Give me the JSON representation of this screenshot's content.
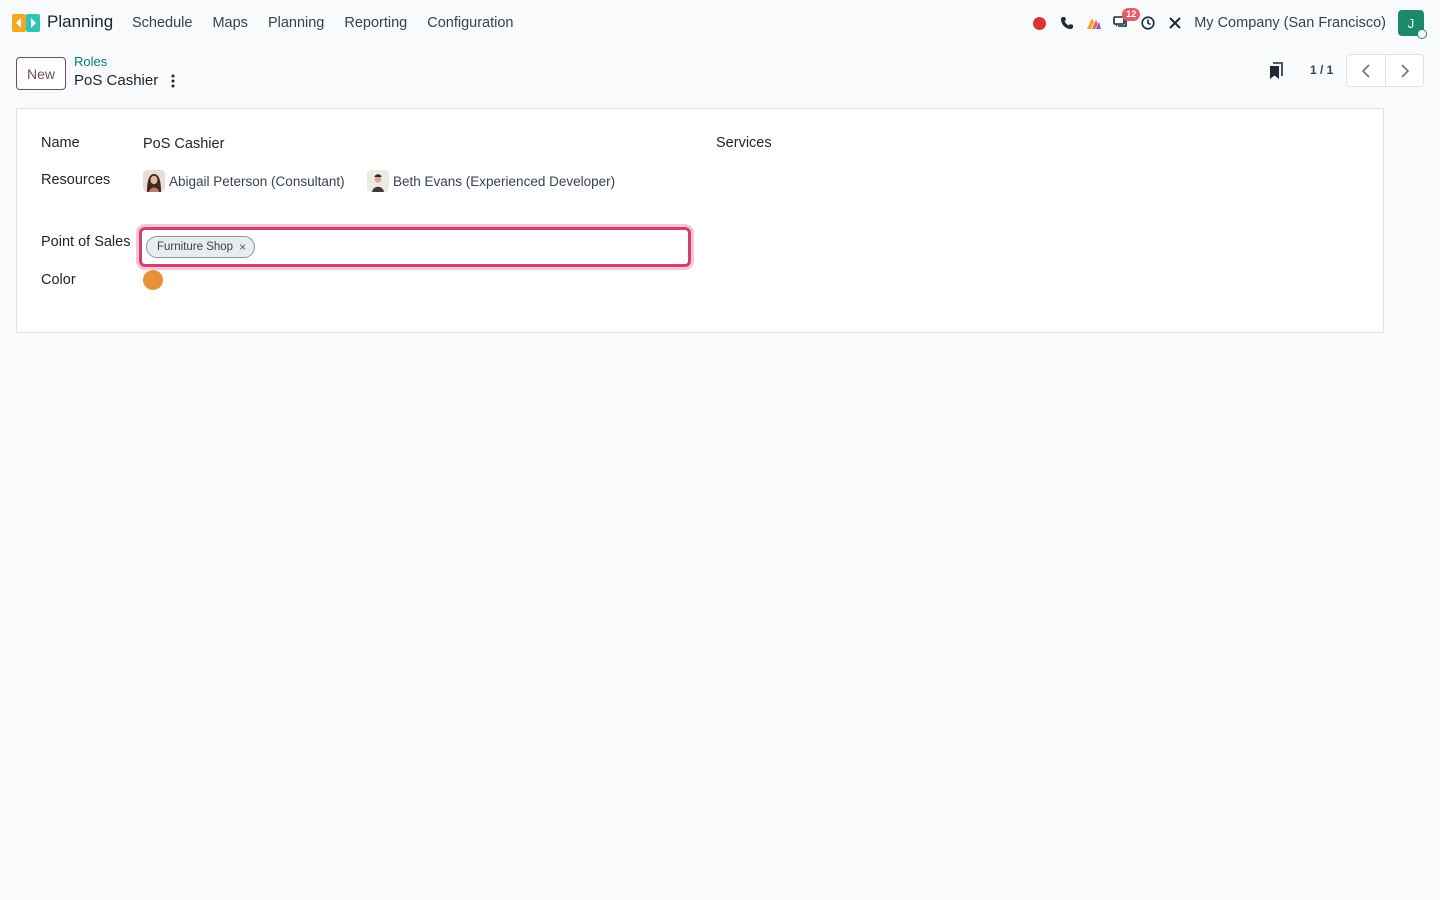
{
  "navbar": {
    "app_name": "Planning",
    "menu": [
      "Schedule",
      "Maps",
      "Planning",
      "Reporting",
      "Configuration"
    ],
    "messages_badge": "12",
    "company": "My Company (San Francisco)",
    "user_initial": "J"
  },
  "control_panel": {
    "new_label": "New",
    "breadcrumb": "Roles",
    "record_title": "PoS Cashier",
    "pager": "1 / 1"
  },
  "form": {
    "name_label": "Name",
    "name_value": "PoS Cashier",
    "services_label": "Services",
    "resources_label": "Resources",
    "resources": [
      "Abigail Peterson (Consultant)",
      "Beth Evans (Experienced Developer)"
    ],
    "pos_label": "Point of Sales",
    "pos_tags": [
      "Furniture Shop"
    ],
    "color_label": "Color",
    "color_value": "#e8913b"
  },
  "colors": {
    "brand": "#714b67",
    "link": "#017e84",
    "focus_border": "#d23f73"
  }
}
